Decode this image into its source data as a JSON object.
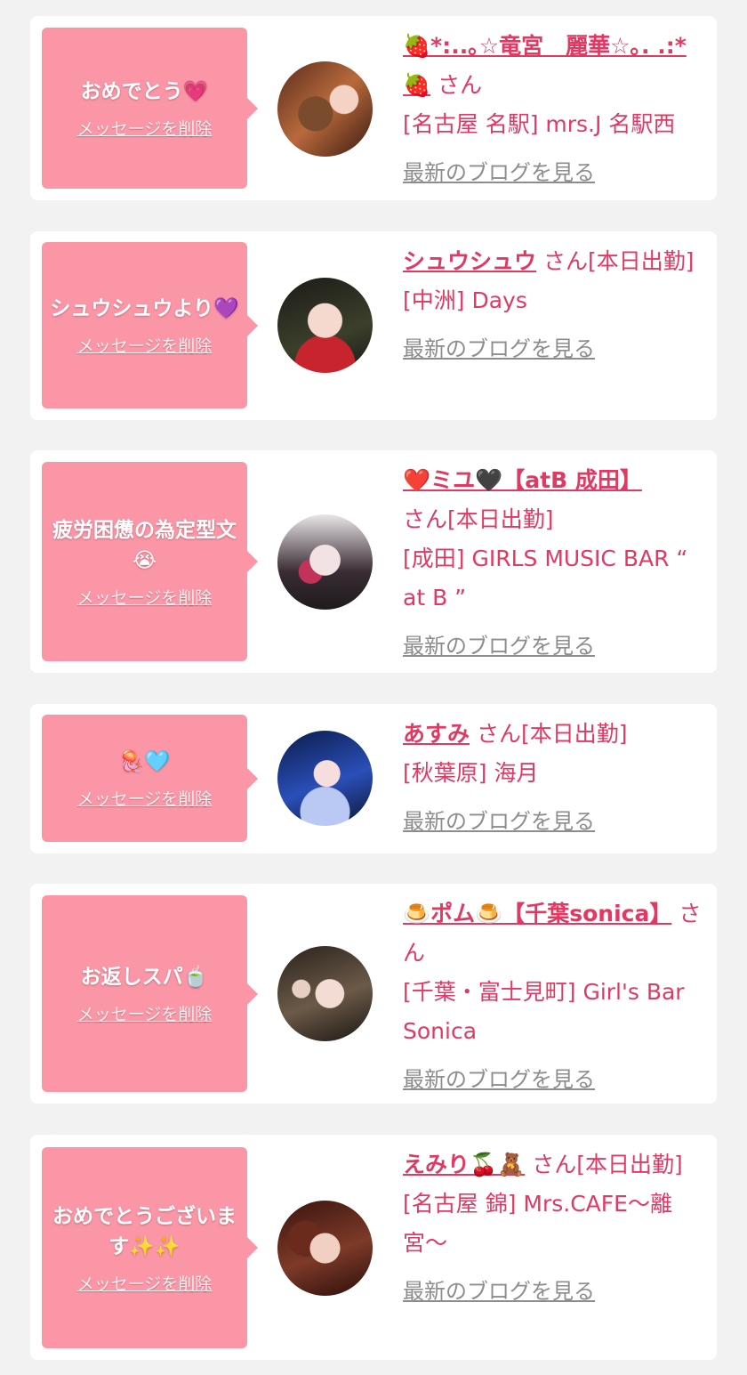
{
  "colors": {
    "accent": "#e03a63",
    "bubble": "#fb96a6",
    "muted": "#8d8d8d",
    "background": "#f2f2f2"
  },
  "cards": [
    {
      "message": "おめでとう💗",
      "delete_label": "メッセージを削除",
      "name": "🍓*:..｡☆竜宮　麗華☆｡. .:*🍓",
      "honorific": "さん",
      "status": "",
      "shop": "[名古屋 名駅] mrs.J 名駅西",
      "blog_label": "最新のブログを見る"
    },
    {
      "message": "シュウシュウより💜",
      "delete_label": "メッセージを削除",
      "name": "シュウシュウ",
      "honorific": "さん",
      "status": "[本日出勤]",
      "shop": "[中洲] Days",
      "blog_label": "最新のブログを見る"
    },
    {
      "message": "疲労困憊の為定型文😭",
      "delete_label": "メッセージを削除",
      "name": "❤️ミユ🖤【atB 成田】",
      "honorific": "さん",
      "status": "[本日出勤]",
      "shop": "[成田] GIRLS MUSIC BAR “ at B ”",
      "blog_label": "最新のブログを見る"
    },
    {
      "message": "🪼🩵",
      "delete_label": "メッセージを削除",
      "name": "あすみ",
      "honorific": "さん",
      "status": "[本日出勤]",
      "shop": "[秋葉原] 海月",
      "blog_label": "最新のブログを見る"
    },
    {
      "message": "お返しスパ🍵",
      "delete_label": "メッセージを削除",
      "name": "🍮ポム🍮【千葉sonica】",
      "honorific": "さん",
      "status": "",
      "shop": "[千葉・富士見町] Girl's Bar Sonica",
      "blog_label": "最新のブログを見る"
    },
    {
      "message": "おめでとうございます✨✨",
      "delete_label": "メッセージを削除",
      "name": "えみり🍒🧸",
      "honorific": "さん",
      "status": "[本日出勤]",
      "shop": "[名古屋 錦] Mrs.CAFE〜離宮〜",
      "blog_label": "最新のブログを見る"
    }
  ]
}
